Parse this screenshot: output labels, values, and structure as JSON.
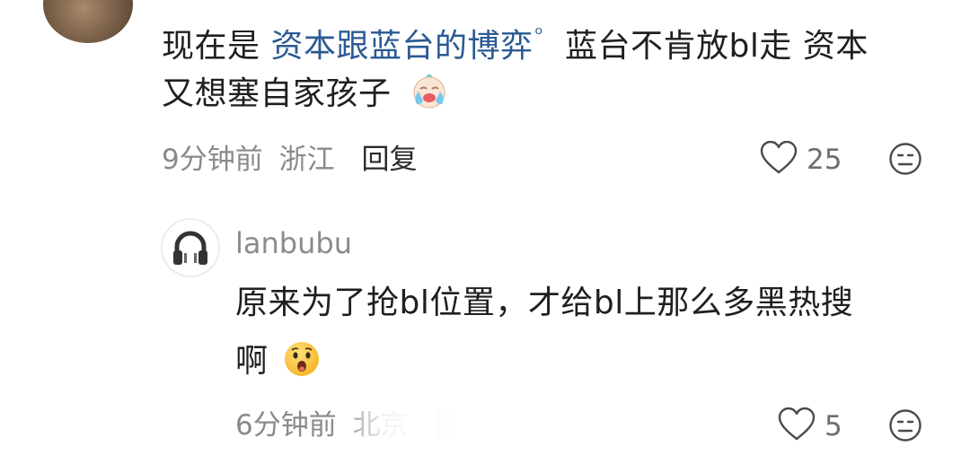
{
  "comment1": {
    "text_prefix": "现在是",
    "topic": "资本跟蓝台的博弈",
    "topic_icon": "search-icon",
    "text_rest": "蓝台不肯放bl走 资本",
    "text_line2": "又想塞自家孩子",
    "emoji": "crying-baby-emoji",
    "time": "9分钟前",
    "location": "浙江",
    "reply_label": "回复",
    "likes": "25"
  },
  "comment2": {
    "username": "lanbubu",
    "text_line1": "原来为了抢bl位置，才给bl上那么多黑热搜",
    "text_line2": "啊",
    "emoji": "surprised-face-emoji",
    "time": "6分钟前",
    "location": "北京",
    "reply_label": "回复",
    "likes": "5"
  },
  "colors": {
    "topic_blue": "#2b5a93",
    "meta_gray": "#8a8a8a"
  }
}
